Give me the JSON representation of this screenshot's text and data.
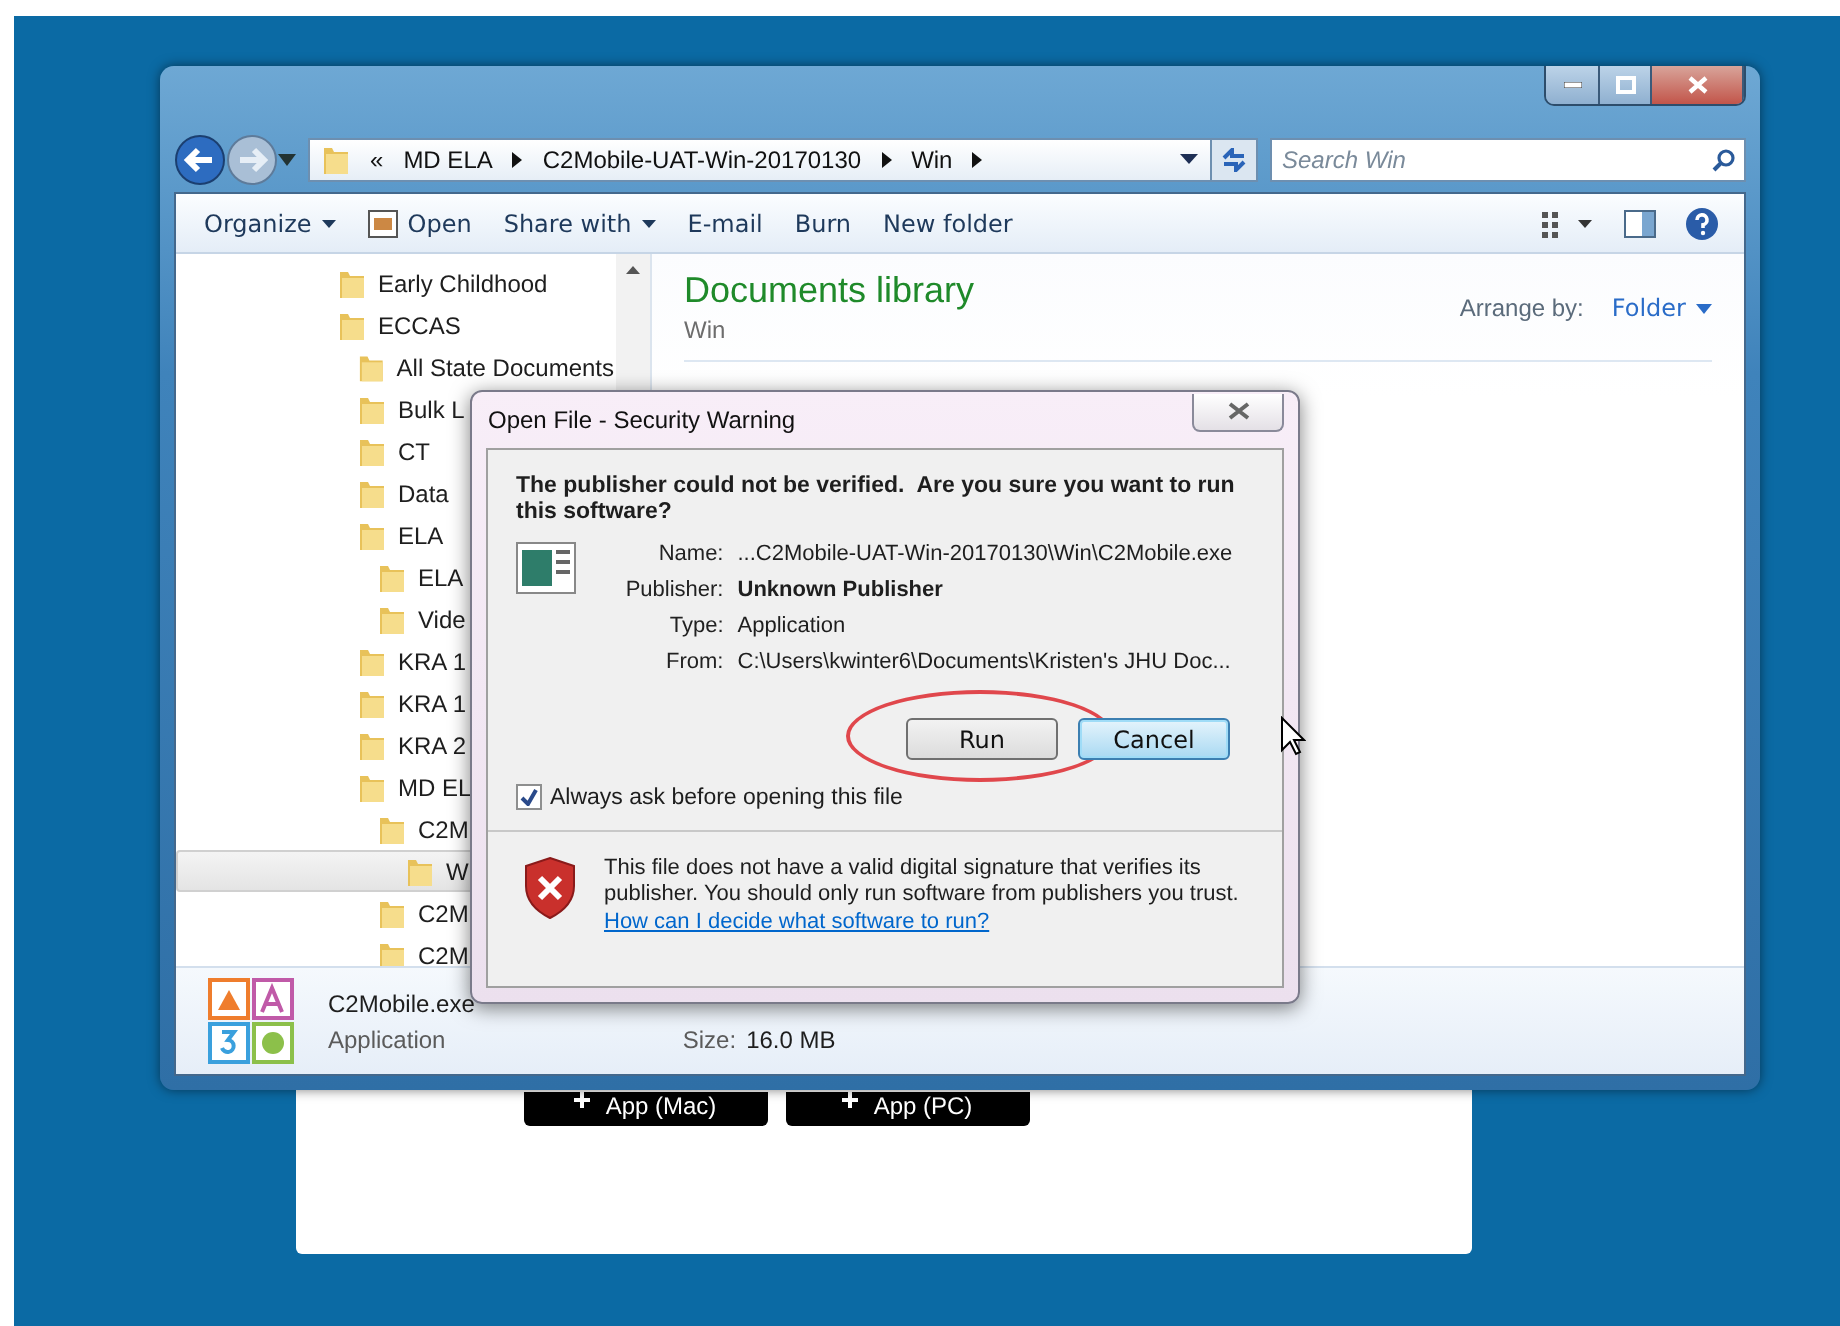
{
  "page_buttons": [
    "App (Mac)",
    "App (PC)"
  ],
  "explorer": {
    "breadcrumb": [
      "«",
      "MD ELA",
      "C2Mobile-UAT-Win-20170130",
      "Win"
    ],
    "search": {
      "placeholder": "Search Win"
    },
    "toolbar": [
      {
        "label": "Organize",
        "kind": "menu"
      },
      {
        "label": "Open",
        "kind": "open"
      },
      {
        "label": "Share with",
        "kind": "menu"
      },
      {
        "label": "E-mail",
        "kind": "plain"
      },
      {
        "label": "Burn",
        "kind": "plain"
      },
      {
        "label": "New folder",
        "kind": "plain"
      }
    ],
    "tree": [
      {
        "label": "Early Childhood",
        "selected": false
      },
      {
        "label": "ECCAS",
        "selected": false,
        "children": [
          {
            "label": "All State Documents",
            "selected": false
          },
          {
            "label": "Bulk L",
            "selected": false
          },
          {
            "label": "CT",
            "selected": false
          },
          {
            "label": "Data",
            "selected": false
          },
          {
            "label": "ELA",
            "selected": false,
            "children": [
              {
                "label": "ELA",
                "selected": false
              },
              {
                "label": "Vide",
                "selected": false
              }
            ]
          },
          {
            "label": "KRA 1",
            "selected": false
          },
          {
            "label": "KRA 1",
            "selected": false
          },
          {
            "label": "KRA 2",
            "selected": false
          },
          {
            "label": "MD EL",
            "selected": false,
            "children": [
              {
                "label": "C2M",
                "selected": false,
                "children": [
                  {
                    "label": "W",
                    "selected": true
                  }
                ]
              },
              {
                "label": "C2M",
                "selected": false
              },
              {
                "label": "C2M",
                "selected": false
              }
            ]
          }
        ]
      }
    ],
    "library": {
      "title": "Documents library",
      "subtitle": "Win",
      "arrange_label": "Arrange by:",
      "arrange_value": "Folder"
    },
    "details": {
      "name": "C2Mobile.exe",
      "type": "Application",
      "size_label": "Size:",
      "size": "16.0 MB"
    }
  },
  "dialog": {
    "title": "Open File - Security Warning",
    "heading": "The publisher could not be verified.  Are you sure you want to run this software?",
    "fields": [
      {
        "label": "Name:",
        "value": "...C2Mobile-UAT-Win-20170130\\Win\\C2Mobile.exe",
        "kind": "plain"
      },
      {
        "label": "Publisher:",
        "value": "Unknown Publisher",
        "kind": "bold"
      },
      {
        "label": "Type:",
        "value": "Application",
        "kind": "plain"
      },
      {
        "label": "From:",
        "value": "C:\\Users\\kwinter6\\Documents\\Kristen's JHU Doc...",
        "kind": "plain"
      }
    ],
    "buttons": [
      {
        "label": "Run",
        "focused": false,
        "circled": true
      },
      {
        "label": "Cancel",
        "focused": true,
        "circled": false
      }
    ],
    "checkbox": {
      "label": "Always ask before opening this file",
      "checked": true
    },
    "warning": "This file does not have a valid digital signature that verifies its publisher.  You should only run software from publishers you trust.",
    "link": "How can I decide what software to run?"
  }
}
